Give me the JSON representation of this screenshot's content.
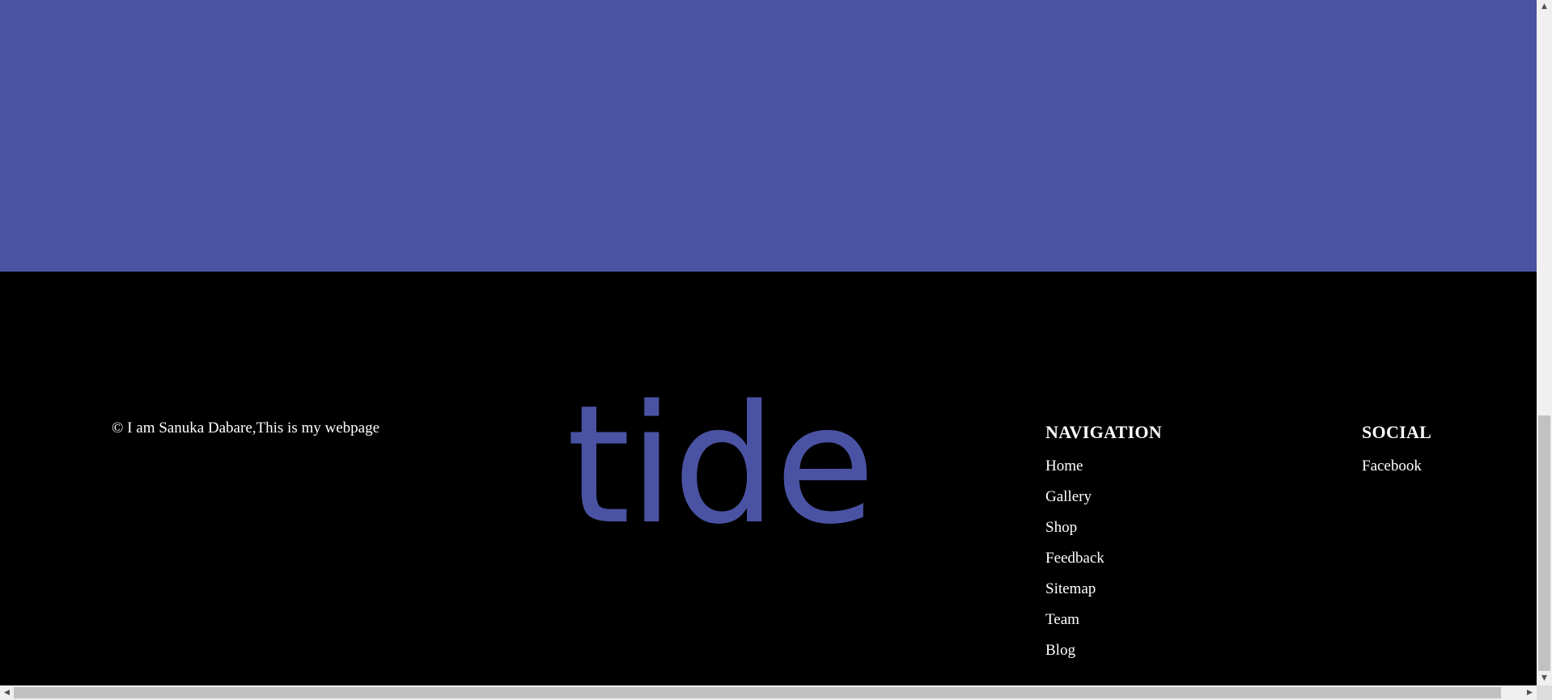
{
  "colors": {
    "banner": "#4a53a3",
    "footer_bg": "#000000",
    "logo": "#4a53a3",
    "text": "#ffffff"
  },
  "footer": {
    "copyright": "© I am Sanuka Dabare,This is my webpage",
    "logo_text": "tide",
    "navigation": {
      "heading": "NAVIGATION",
      "items": [
        "Home",
        "Gallery",
        "Shop",
        "Feedback",
        "Sitemap",
        "Team",
        "Blog"
      ]
    },
    "social": {
      "heading": "SOCIAL",
      "items": [
        "Facebook"
      ]
    }
  },
  "scrollbars": {
    "up_arrow": "▲",
    "down_arrow": "▼",
    "left_arrow": "◀",
    "right_arrow": "▶"
  }
}
